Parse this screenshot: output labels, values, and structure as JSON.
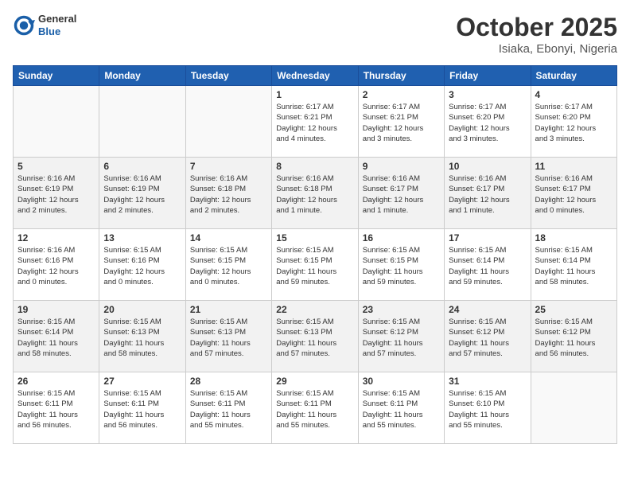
{
  "header": {
    "logo_general": "General",
    "logo_blue": "Blue",
    "title": "October 2025",
    "subtitle": "Isiaka, Ebonyi, Nigeria"
  },
  "days_of_week": [
    "Sunday",
    "Monday",
    "Tuesday",
    "Wednesday",
    "Thursday",
    "Friday",
    "Saturday"
  ],
  "weeks": [
    {
      "shade": false,
      "days": [
        {
          "num": "",
          "info": ""
        },
        {
          "num": "",
          "info": ""
        },
        {
          "num": "",
          "info": ""
        },
        {
          "num": "1",
          "info": "Sunrise: 6:17 AM\nSunset: 6:21 PM\nDaylight: 12 hours\nand 4 minutes."
        },
        {
          "num": "2",
          "info": "Sunrise: 6:17 AM\nSunset: 6:21 PM\nDaylight: 12 hours\nand 3 minutes."
        },
        {
          "num": "3",
          "info": "Sunrise: 6:17 AM\nSunset: 6:20 PM\nDaylight: 12 hours\nand 3 minutes."
        },
        {
          "num": "4",
          "info": "Sunrise: 6:17 AM\nSunset: 6:20 PM\nDaylight: 12 hours\nand 3 minutes."
        }
      ]
    },
    {
      "shade": true,
      "days": [
        {
          "num": "5",
          "info": "Sunrise: 6:16 AM\nSunset: 6:19 PM\nDaylight: 12 hours\nand 2 minutes."
        },
        {
          "num": "6",
          "info": "Sunrise: 6:16 AM\nSunset: 6:19 PM\nDaylight: 12 hours\nand 2 minutes."
        },
        {
          "num": "7",
          "info": "Sunrise: 6:16 AM\nSunset: 6:18 PM\nDaylight: 12 hours\nand 2 minutes."
        },
        {
          "num": "8",
          "info": "Sunrise: 6:16 AM\nSunset: 6:18 PM\nDaylight: 12 hours\nand 1 minute."
        },
        {
          "num": "9",
          "info": "Sunrise: 6:16 AM\nSunset: 6:17 PM\nDaylight: 12 hours\nand 1 minute."
        },
        {
          "num": "10",
          "info": "Sunrise: 6:16 AM\nSunset: 6:17 PM\nDaylight: 12 hours\nand 1 minute."
        },
        {
          "num": "11",
          "info": "Sunrise: 6:16 AM\nSunset: 6:17 PM\nDaylight: 12 hours\nand 0 minutes."
        }
      ]
    },
    {
      "shade": false,
      "days": [
        {
          "num": "12",
          "info": "Sunrise: 6:16 AM\nSunset: 6:16 PM\nDaylight: 12 hours\nand 0 minutes."
        },
        {
          "num": "13",
          "info": "Sunrise: 6:15 AM\nSunset: 6:16 PM\nDaylight: 12 hours\nand 0 minutes."
        },
        {
          "num": "14",
          "info": "Sunrise: 6:15 AM\nSunset: 6:15 PM\nDaylight: 12 hours\nand 0 minutes."
        },
        {
          "num": "15",
          "info": "Sunrise: 6:15 AM\nSunset: 6:15 PM\nDaylight: 11 hours\nand 59 minutes."
        },
        {
          "num": "16",
          "info": "Sunrise: 6:15 AM\nSunset: 6:15 PM\nDaylight: 11 hours\nand 59 minutes."
        },
        {
          "num": "17",
          "info": "Sunrise: 6:15 AM\nSunset: 6:14 PM\nDaylight: 11 hours\nand 59 minutes."
        },
        {
          "num": "18",
          "info": "Sunrise: 6:15 AM\nSunset: 6:14 PM\nDaylight: 11 hours\nand 58 minutes."
        }
      ]
    },
    {
      "shade": true,
      "days": [
        {
          "num": "19",
          "info": "Sunrise: 6:15 AM\nSunset: 6:14 PM\nDaylight: 11 hours\nand 58 minutes."
        },
        {
          "num": "20",
          "info": "Sunrise: 6:15 AM\nSunset: 6:13 PM\nDaylight: 11 hours\nand 58 minutes."
        },
        {
          "num": "21",
          "info": "Sunrise: 6:15 AM\nSunset: 6:13 PM\nDaylight: 11 hours\nand 57 minutes."
        },
        {
          "num": "22",
          "info": "Sunrise: 6:15 AM\nSunset: 6:13 PM\nDaylight: 11 hours\nand 57 minutes."
        },
        {
          "num": "23",
          "info": "Sunrise: 6:15 AM\nSunset: 6:12 PM\nDaylight: 11 hours\nand 57 minutes."
        },
        {
          "num": "24",
          "info": "Sunrise: 6:15 AM\nSunset: 6:12 PM\nDaylight: 11 hours\nand 57 minutes."
        },
        {
          "num": "25",
          "info": "Sunrise: 6:15 AM\nSunset: 6:12 PM\nDaylight: 11 hours\nand 56 minutes."
        }
      ]
    },
    {
      "shade": false,
      "days": [
        {
          "num": "26",
          "info": "Sunrise: 6:15 AM\nSunset: 6:11 PM\nDaylight: 11 hours\nand 56 minutes."
        },
        {
          "num": "27",
          "info": "Sunrise: 6:15 AM\nSunset: 6:11 PM\nDaylight: 11 hours\nand 56 minutes."
        },
        {
          "num": "28",
          "info": "Sunrise: 6:15 AM\nSunset: 6:11 PM\nDaylight: 11 hours\nand 55 minutes."
        },
        {
          "num": "29",
          "info": "Sunrise: 6:15 AM\nSunset: 6:11 PM\nDaylight: 11 hours\nand 55 minutes."
        },
        {
          "num": "30",
          "info": "Sunrise: 6:15 AM\nSunset: 6:11 PM\nDaylight: 11 hours\nand 55 minutes."
        },
        {
          "num": "31",
          "info": "Sunrise: 6:15 AM\nSunset: 6:10 PM\nDaylight: 11 hours\nand 55 minutes."
        },
        {
          "num": "",
          "info": ""
        }
      ]
    }
  ]
}
